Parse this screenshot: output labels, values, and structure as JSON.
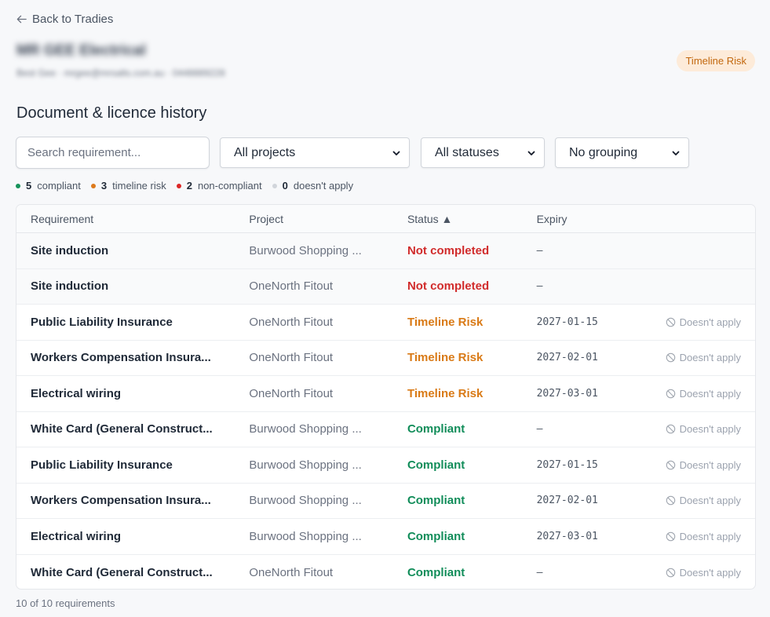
{
  "nav": {
    "back_label": "Back to Tradies"
  },
  "tradie": {
    "name": "MR GEE Electrical",
    "meta": "Best Gee · mrgee@mrsalts.com.au · 0448889228",
    "badge": "Timeline Risk"
  },
  "section": {
    "title": "Document & licence history"
  },
  "filters": {
    "search_placeholder": "Search requirement...",
    "project": "All projects",
    "status": "All statuses",
    "grouping": "No grouping"
  },
  "summary": [
    {
      "count": "5",
      "label": "compliant",
      "color": "#16925a"
    },
    {
      "count": "3",
      "label": "timeline risk",
      "color": "#dd7a1c"
    },
    {
      "count": "2",
      "label": "non-compliant",
      "color": "#dc2626"
    },
    {
      "count": "0",
      "label": "doesn't apply",
      "color": "#d1d5db"
    }
  ],
  "colors": {
    "Not completed": "#d12c2c",
    "Timeline Risk": "#d97a16",
    "Compliant": "#128d5a"
  },
  "table": {
    "headers": {
      "requirement": "Requirement",
      "project": "Project",
      "status": "Status ▲",
      "expiry": "Expiry"
    },
    "action_label": "Doesn't apply",
    "rows": [
      {
        "requirement": "Site induction",
        "project": "Burwood Shopping ...",
        "status": "Not completed",
        "expiry": "–",
        "action": false
      },
      {
        "requirement": "Site induction",
        "project": "OneNorth Fitout",
        "status": "Not completed",
        "expiry": "–",
        "action": false
      },
      {
        "requirement": "Public Liability Insurance",
        "project": "OneNorth Fitout",
        "status": "Timeline Risk",
        "expiry": "2027-01-15",
        "action": true
      },
      {
        "requirement": "Workers Compensation Insura...",
        "project": "OneNorth Fitout",
        "status": "Timeline Risk",
        "expiry": "2027-02-01",
        "action": true
      },
      {
        "requirement": "Electrical wiring",
        "project": "OneNorth Fitout",
        "status": "Timeline Risk",
        "expiry": "2027-03-01",
        "action": true
      },
      {
        "requirement": "White Card (General Construct...",
        "project": "Burwood Shopping ...",
        "status": "Compliant",
        "expiry": "–",
        "action": true
      },
      {
        "requirement": "Public Liability Insurance",
        "project": "Burwood Shopping ...",
        "status": "Compliant",
        "expiry": "2027-01-15",
        "action": true
      },
      {
        "requirement": "Workers Compensation Insura...",
        "project": "Burwood Shopping ...",
        "status": "Compliant",
        "expiry": "2027-02-01",
        "action": true
      },
      {
        "requirement": "Electrical wiring",
        "project": "Burwood Shopping ...",
        "status": "Compliant",
        "expiry": "2027-03-01",
        "action": true
      },
      {
        "requirement": "White Card (General Construct...",
        "project": "OneNorth Fitout",
        "status": "Compliant",
        "expiry": "–",
        "action": true
      }
    ]
  },
  "footer": {
    "count_text": "10 of 10 requirements"
  }
}
